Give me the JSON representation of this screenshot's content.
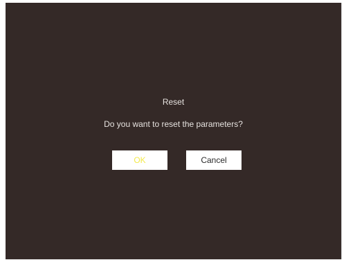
{
  "dialog": {
    "title": "Reset",
    "message": "Do you want to reset the parameters?",
    "ok_label": "OK",
    "cancel_label": "Cancel"
  },
  "colors": {
    "background": "#342927",
    "text": "#e6e2df",
    "button_background": "#ffffff",
    "ok_text": "#f3ea4b",
    "cancel_text": "#2a2a2a"
  }
}
